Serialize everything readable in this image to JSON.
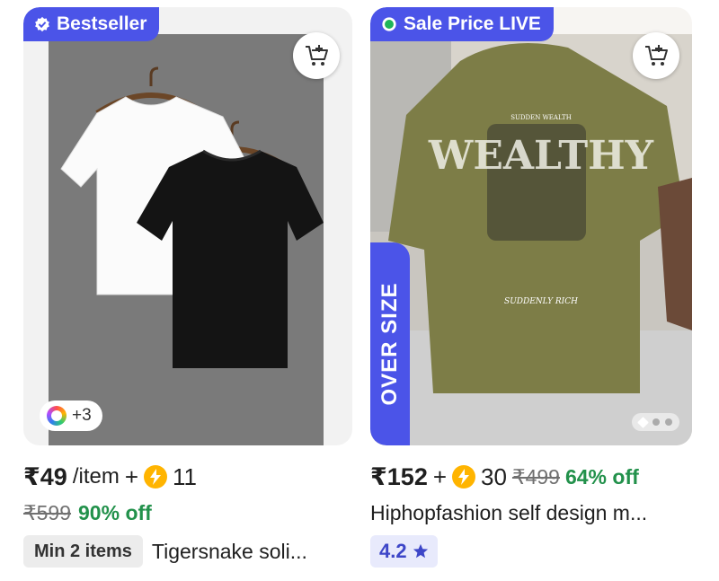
{
  "products": [
    {
      "badge": "Bestseller",
      "badge_icon": "verified-check-icon",
      "more_colors": "+3",
      "price": "₹49",
      "per_unit": "/item",
      "plus": "+",
      "coins": "11",
      "mrp": "₹599",
      "discount": "90% off",
      "min_items": "Min 2 items",
      "title": "Tigersnake soli..."
    },
    {
      "badge": "Sale Price LIVE",
      "badge_icon": "live-dot-icon",
      "tag": "OVER SIZE",
      "image_text": [
        "SUDDEN WEALTH",
        "WEALTHY",
        "SUDDENLY RICH"
      ],
      "carousel": {
        "count": 3,
        "active": 1
      },
      "price": "₹152",
      "plus": "+",
      "coins": "30",
      "mrp": "₹499",
      "discount": "64% off",
      "title": "Hiphopfashion self design m...",
      "rating": "4.2",
      "rating_icon": "star-icon"
    }
  ],
  "colors": {
    "accent": "#4b54e8",
    "discount_green": "#22914b",
    "coin_yellow": "#ffb400",
    "rating_blue": "#3d46c8"
  }
}
